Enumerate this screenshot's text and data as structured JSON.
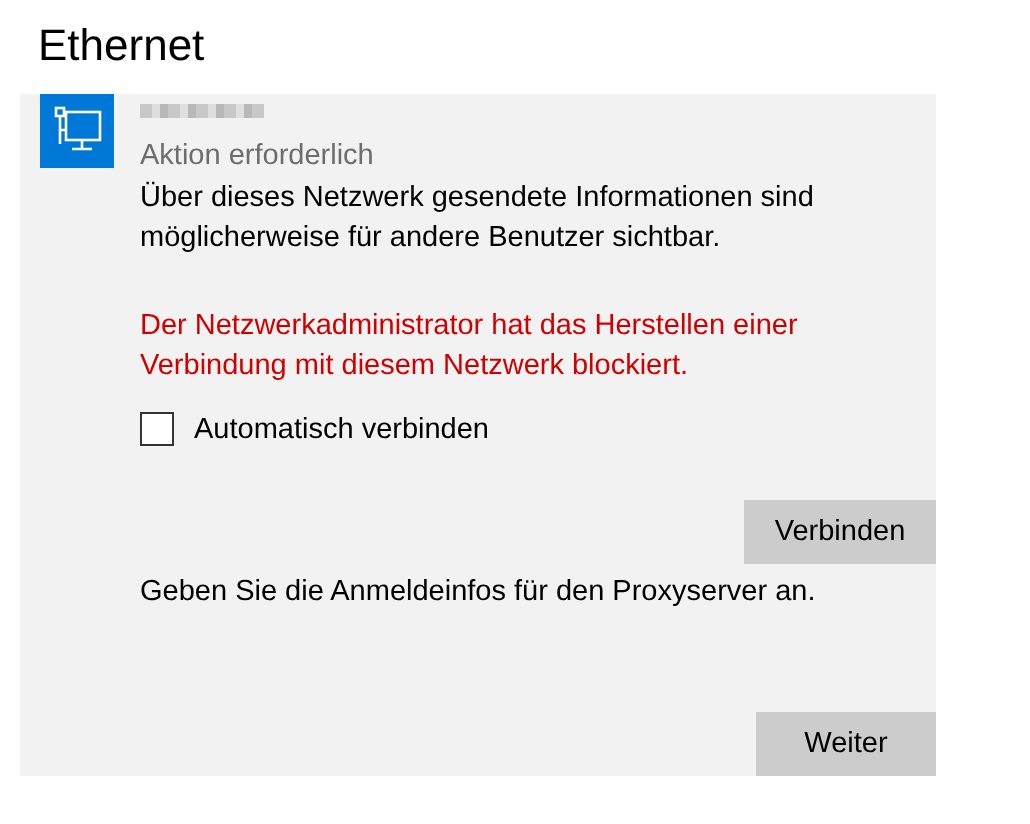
{
  "page": {
    "title": "Ethernet"
  },
  "network": {
    "status": "Aktion erforderlich",
    "info": "Über dieses Netzwerk gesendete Informationen sind möglicherweise für andere Benutzer sichtbar.",
    "error": "Der Netzwerkadministrator hat das Herstellen einer Verbindung mit diesem Netzwerk blockiert.",
    "auto_connect": {
      "label": "Automatisch verbinden",
      "checked": false
    },
    "connect_button": "Verbinden"
  },
  "proxy": {
    "prompt": "Geben Sie die Anmeldeinfos für den Proxyserver an.",
    "next_button": "Weiter"
  }
}
